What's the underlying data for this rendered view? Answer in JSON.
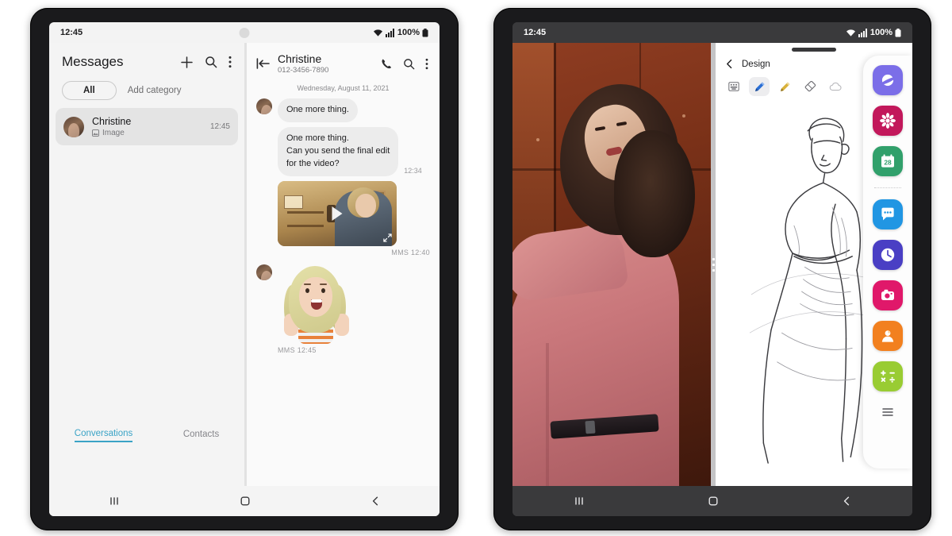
{
  "left_device": {
    "statusbar": {
      "time": "12:45",
      "battery": "100%",
      "wifi_icon": "wifi-icon",
      "signal_icon": "signal-icon",
      "battery_icon": "battery-icon"
    },
    "messages_app": {
      "title": "Messages",
      "header_icons": [
        {
          "name": "new-message-icon",
          "glyph": "+"
        },
        {
          "name": "search-icon",
          "glyph": "search"
        },
        {
          "name": "more-options-icon",
          "glyph": "kebab"
        }
      ],
      "chips": [
        {
          "label": "All",
          "selected": true
        },
        {
          "label": "Add category",
          "selected": false
        }
      ],
      "conversations": [
        {
          "name": "Christine",
          "preview": "Image",
          "preview_icon": "image-icon",
          "time": "12:45",
          "selected": true
        }
      ],
      "tabs": [
        {
          "label": "Conversations",
          "active": true
        },
        {
          "label": "Contacts",
          "active": false
        }
      ],
      "accent_color": "#3aa3c6"
    },
    "chat": {
      "back_icon": "back-to-list-icon",
      "contact_name": "Christine",
      "contact_number": "012-3456-7890",
      "header_icons": [
        {
          "name": "call-icon",
          "glyph": "phone"
        },
        {
          "name": "search-icon",
          "glyph": "search"
        },
        {
          "name": "more-options-icon",
          "glyph": "kebab"
        }
      ],
      "date_separator": "Wednesday, August 11, 2021",
      "messages": [
        {
          "type": "text",
          "text": "One more thing.",
          "time": ""
        },
        {
          "type": "text",
          "text": "One more thing.\nCan you send the final edit\nfor the video?",
          "time": "12:34"
        },
        {
          "type": "video",
          "label": "MMS  12:40",
          "play_icon": "play-icon",
          "expand_icon": "expand-icon"
        },
        {
          "type": "sticker",
          "label": "MMS  12:45",
          "sticker_name": "ar-emoji-sticker"
        }
      ],
      "composer": {
        "icons": [
          {
            "name": "gallery-icon"
          },
          {
            "name": "camera-icon"
          },
          {
            "name": "add-attachment-icon"
          }
        ],
        "input_placeholder": "",
        "input_value": "",
        "sticker_icon": "sticker-icon",
        "voice_icon": "voice-recorder-icon"
      }
    },
    "navbar": [
      {
        "name": "recents-button",
        "glyph": "|||"
      },
      {
        "name": "home-button",
        "glyph": "square"
      },
      {
        "name": "back-button",
        "glyph": "chevron-left"
      }
    ]
  },
  "right_device": {
    "statusbar": {
      "time": "12:45",
      "battery": "100%",
      "wifi_icon": "wifi-icon",
      "signal_icon": "signal-icon",
      "battery_icon": "battery-icon"
    },
    "gallery_pane": {
      "name": "photo-viewer",
      "subject": "fashion-photo"
    },
    "design_app": {
      "back_icon": "back-icon",
      "title": "Design",
      "tools": [
        {
          "name": "text-tool",
          "active": false,
          "color": "#6e6e73"
        },
        {
          "name": "pen-tool",
          "active": true,
          "color": "#2b6fd4"
        },
        {
          "name": "highlighter-tool",
          "active": false,
          "color": "#d9b23c"
        },
        {
          "name": "eraser-tool",
          "active": false,
          "color": "#6e6e73"
        },
        {
          "name": "cloud-sync-tool",
          "active": false,
          "color": "#b9b9bd"
        }
      ],
      "canvas": {
        "name": "sketch-canvas",
        "content": "fashion-figure-sketch"
      }
    },
    "edge_panel": {
      "apps": [
        {
          "name": "internet-app-icon",
          "label": "Internet",
          "color": "#7b6ee8",
          "glyph": "saturn"
        },
        {
          "name": "gallery-app-icon",
          "label": "Gallery",
          "color": "#c2185b",
          "glyph": "flower"
        },
        {
          "name": "calendar-app-icon",
          "label": "Calendar",
          "color": "#31a06b",
          "glyph": "28"
        },
        {
          "name": "messages-app-icon",
          "label": "Messages",
          "color": "#2196e3",
          "glyph": "chat"
        },
        {
          "name": "clock-app-icon",
          "label": "Clock",
          "color": "#4a3fc4",
          "glyph": "clock"
        },
        {
          "name": "camera-app-icon",
          "label": "Camera",
          "color": "#e0186a",
          "glyph": "camera"
        },
        {
          "name": "contacts-app-icon",
          "label": "Contacts",
          "color": "#f2801f",
          "glyph": "person"
        },
        {
          "name": "calculator-app-icon",
          "label": "Calculator",
          "color": "#99cc33",
          "glyph": "calc"
        }
      ],
      "divider_after_index": 2,
      "menu_icon": "edge-panel-menu-icon"
    },
    "navbar": [
      {
        "name": "recents-button",
        "glyph": "|||"
      },
      {
        "name": "home-button",
        "glyph": "square"
      },
      {
        "name": "back-button",
        "glyph": "chevron-left"
      }
    ]
  }
}
